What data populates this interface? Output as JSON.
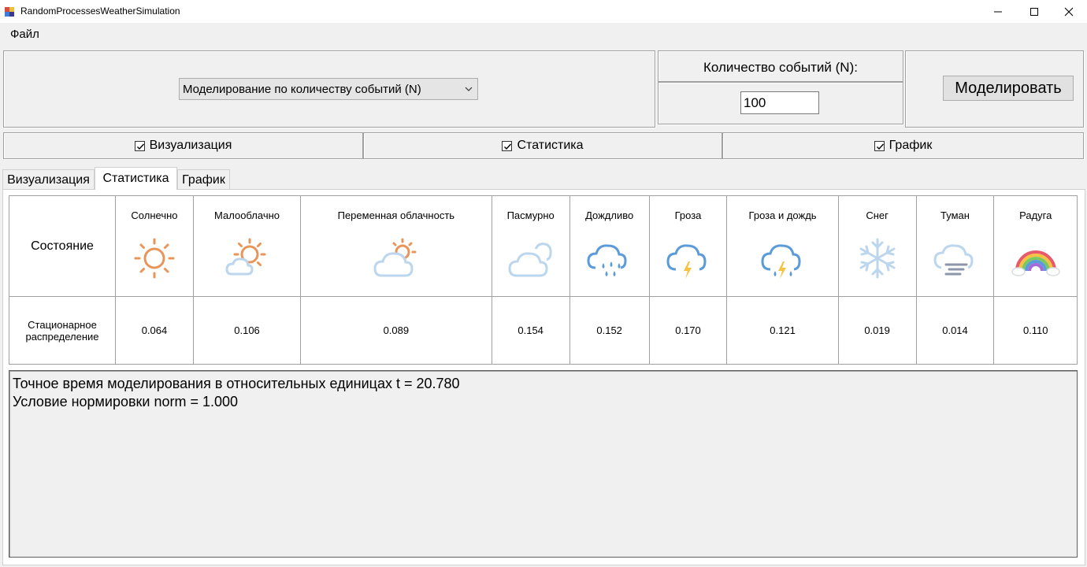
{
  "window": {
    "title": "RandomProcessesWeatherSimulation"
  },
  "menu": {
    "file": "Файл"
  },
  "controls": {
    "mode_selected": "Моделирование по количеству событий (N)",
    "count_label": "Количество событий (N):",
    "count_value": "100",
    "simulate_button": "Моделировать"
  },
  "checkboxes": [
    {
      "label": "Визуализация",
      "checked": true
    },
    {
      "label": "Статистика",
      "checked": true
    },
    {
      "label": "График",
      "checked": true
    }
  ],
  "tabs": [
    {
      "label": "Визуализация",
      "active": false
    },
    {
      "label": "Статистика",
      "active": true
    },
    {
      "label": "График",
      "active": false
    }
  ],
  "stats": {
    "row_header_state": "Состояние",
    "row_header_dist": "Стационарное распределение",
    "states": [
      {
        "name": "Солнечно",
        "icon": "sun-icon",
        "value": "0.064"
      },
      {
        "name": "Малооблачно",
        "icon": "sun-cloud-icon",
        "value": "0.106"
      },
      {
        "name": "Переменная облачность",
        "icon": "partly-cloudy-icon",
        "value": "0.089"
      },
      {
        "name": "Пасмурно",
        "icon": "cloudy-icon",
        "value": "0.154"
      },
      {
        "name": "Дождливо",
        "icon": "rain-icon",
        "value": "0.152"
      },
      {
        "name": "Гроза",
        "icon": "thunderstorm-icon",
        "value": "0.170"
      },
      {
        "name": "Гроза и дождь",
        "icon": "thunder-rain-icon",
        "value": "0.121"
      },
      {
        "name": "Снег",
        "icon": "snowflake-icon",
        "value": "0.019"
      },
      {
        "name": "Туман",
        "icon": "fog-icon",
        "value": "0.014"
      },
      {
        "name": "Радуга",
        "icon": "rainbow-icon",
        "value": "0.110"
      }
    ]
  },
  "output": {
    "lines": [
      "Точное время моделирования в относительных единицах t = 20.780",
      "Условие нормировки norm = 1.000"
    ]
  },
  "colors": {
    "sun": "#e8955a",
    "cloud": "#bcd6ee",
    "rain": "#5b9bd9",
    "bolt": "#f5c242"
  }
}
